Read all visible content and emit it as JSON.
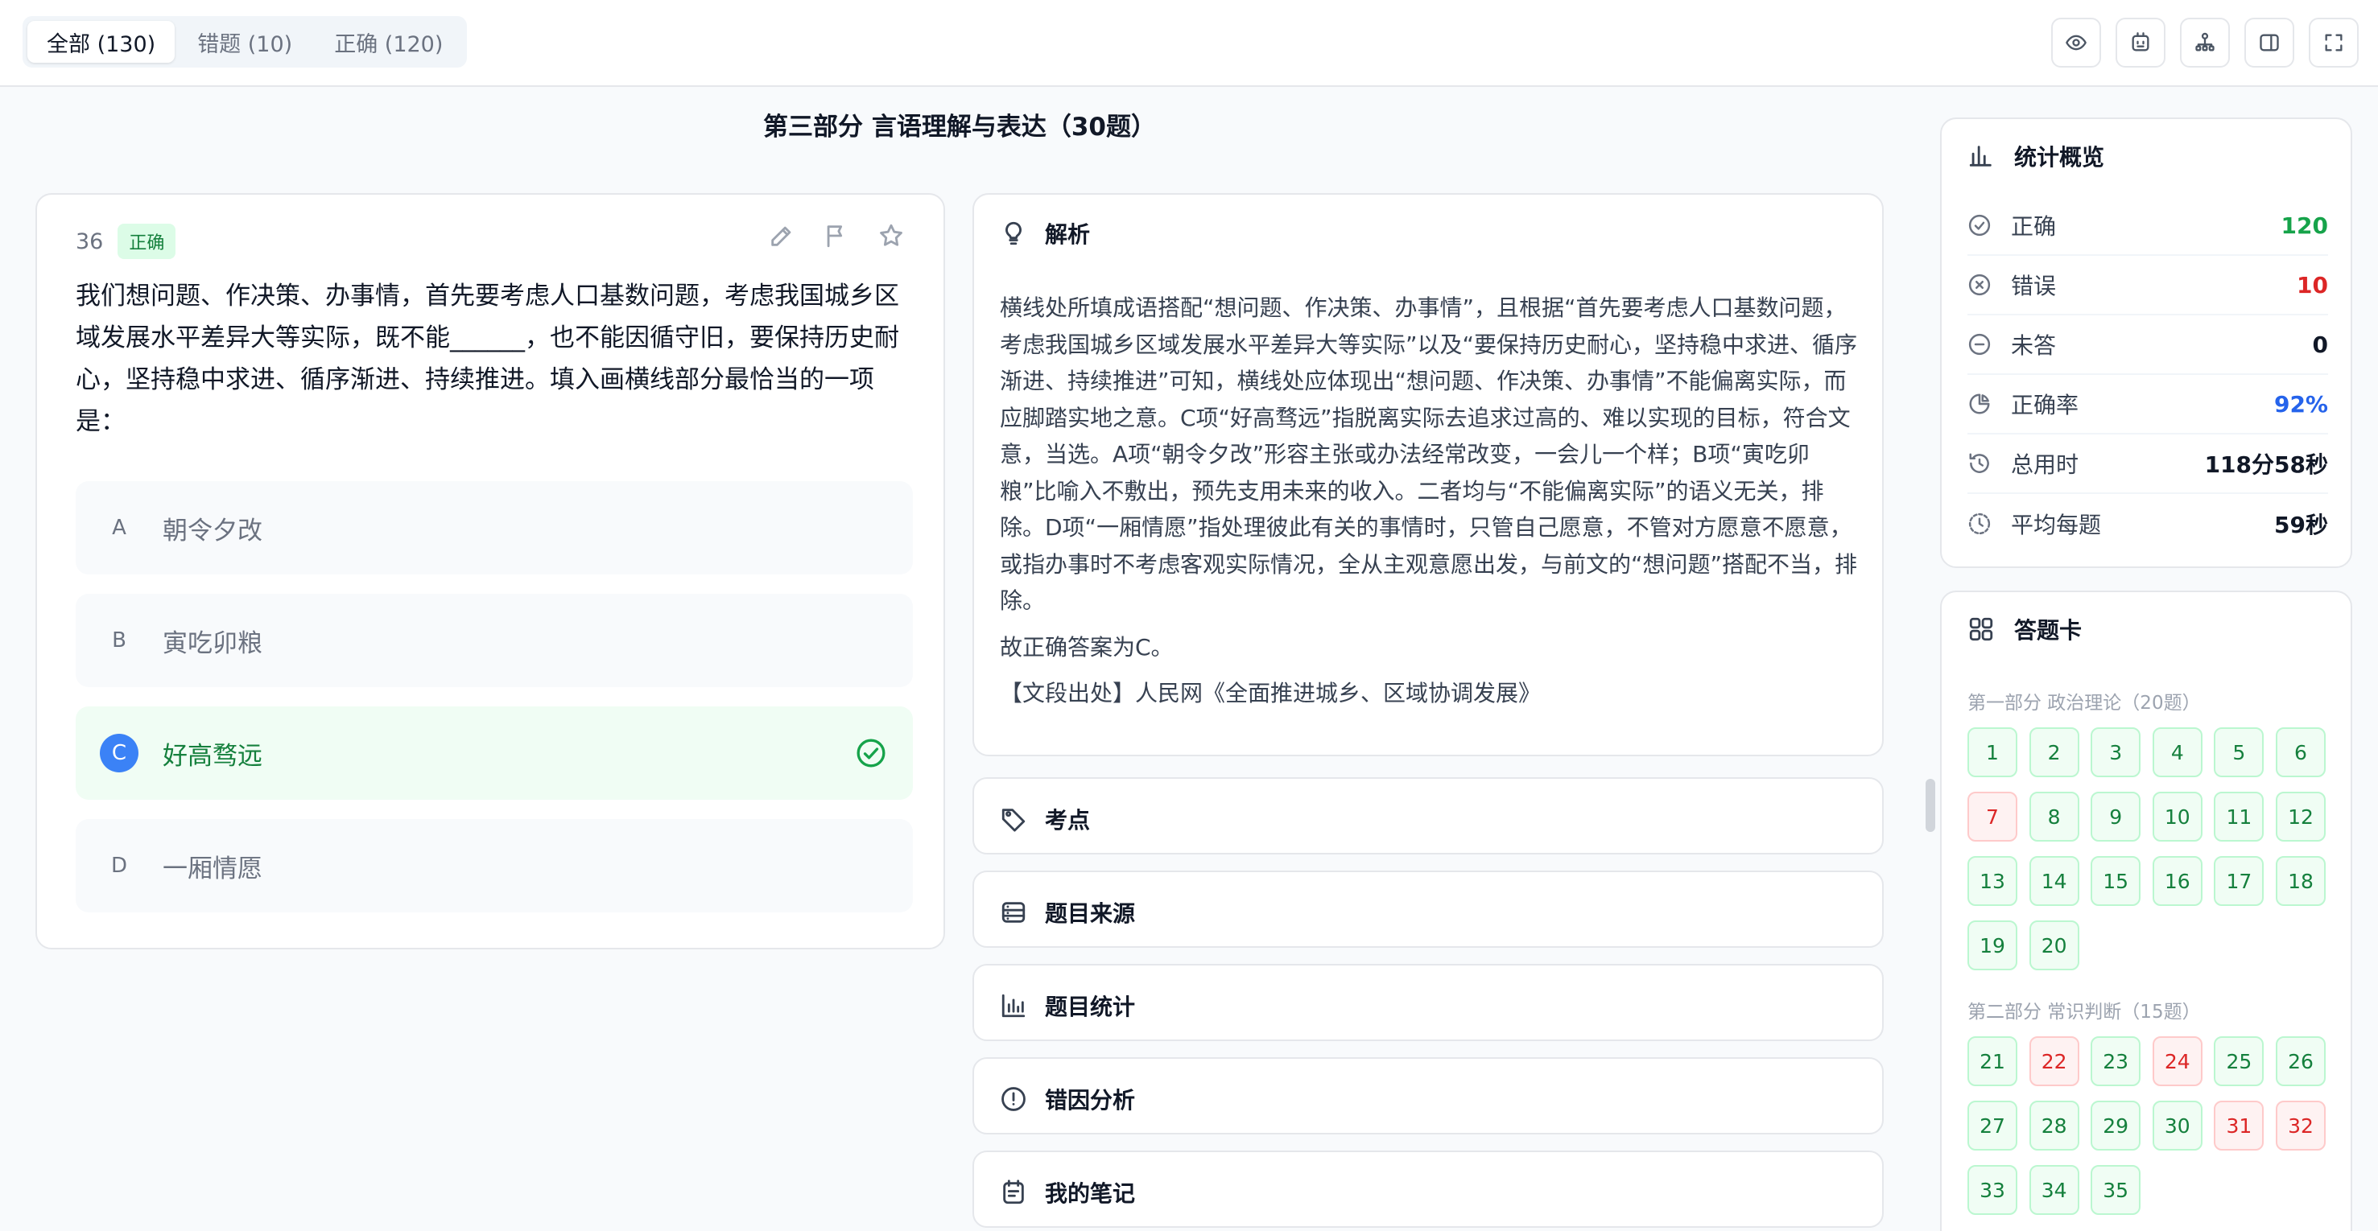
{
  "filters": [
    {
      "label": "全部 (130)",
      "active": true
    },
    {
      "label": "错题 (10)",
      "active": false
    },
    {
      "label": "正确 (120)",
      "active": false
    }
  ],
  "toolbar_icons": [
    "eye-icon",
    "ai-icon",
    "user-tree-icon",
    "sidebar-toggle-icon",
    "fullscreen-icon"
  ],
  "section_title": "第三部分 言语理解与表达（30题）",
  "question": {
    "number": "36",
    "status": "正确",
    "text": "我们想问题、作决策、办事情，首先要考虑人口基数问题，考虑我国城乡区域发展水平差异大等实际，既不能______，也不能因循守旧，要保持历史耐心，坚持稳中求进、循序渐进、持续推进。填入画横线部分最恰当的一项是：",
    "options": [
      {
        "letter": "A",
        "text": "朝令夕改",
        "correct": false
      },
      {
        "letter": "B",
        "text": "寅吃卯粮",
        "correct": false
      },
      {
        "letter": "C",
        "text": "好高骛远",
        "correct": true
      },
      {
        "letter": "D",
        "text": "一厢情愿",
        "correct": false
      }
    ]
  },
  "analysis": {
    "title": "解析",
    "paragraphs": [
      "横线处所填成语搭配“想问题、作决策、办事情”，且根据“首先要考虑人口基数问题，考虑我国城乡区域发展水平差异大等实际”以及“要保持历史耐心，坚持稳中求进、循序渐进、持续推进”可知，横线处应体现出“想问题、作决策、办事情”不能偏离实际，而应脚踏实地之意。C项“好高骛远”指脱离实际去追求过高的、难以实现的目标，符合文意，当选。A项“朝令夕改”形容主张或办法经常改变，一会儿一个样；B项“寅吃卯粮”比喻入不敷出，预先支用未来的收入。二者均与“不能偏离实际”的语义无关，排除。D项“一厢情愿”指处理彼此有关的事情时，只管自己愿意，不管对方愿意不愿意，或指办事时不考虑客观实际情况，全从主观意愿出发，与前文的“想问题”搭配不当，排除。",
      "故正确答案为C。",
      "【文段出处】人民网《全面推进城乡、区域协调发展》"
    ]
  },
  "panels": [
    "考点",
    "题目来源",
    "题目统计",
    "错因分析",
    "我的笔记"
  ],
  "stats": {
    "title": "统计概览",
    "rows": [
      {
        "label": "正确",
        "value": "120",
        "color": "#16a34a"
      },
      {
        "label": "错误",
        "value": "10",
        "color": "#dc2626"
      },
      {
        "label": "未答",
        "value": "0",
        "color": "#111827"
      },
      {
        "label": "正确率",
        "value": "92%",
        "color": "#2563eb"
      },
      {
        "label": "总用时",
        "value": "118分58秒",
        "color": "#111827"
      },
      {
        "label": "平均每题",
        "value": "59秒",
        "color": "#111827"
      }
    ]
  },
  "answer_card": {
    "title": "答题卡",
    "parts": [
      {
        "label": "第一部分 政治理论（20题）",
        "start": 1,
        "count": 20,
        "wrong": [
          7
        ]
      },
      {
        "label": "第二部分 常识判断（15题）",
        "start": 21,
        "count": 15,
        "wrong": [
          22,
          24,
          31,
          32
        ]
      }
    ]
  }
}
